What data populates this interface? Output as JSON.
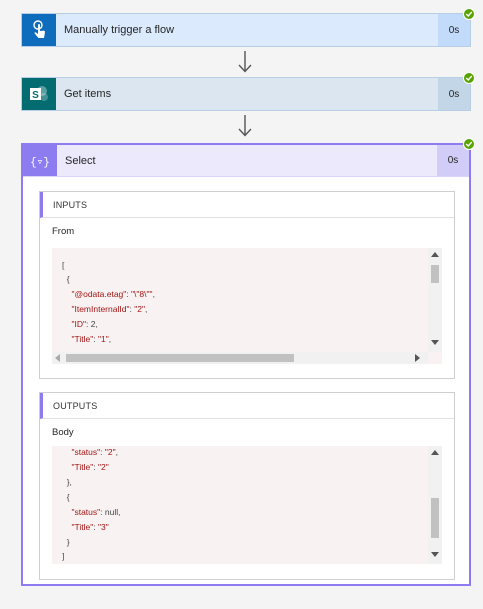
{
  "steps": [
    {
      "title": "Manually trigger a flow",
      "duration": "0s",
      "color": "#0f6cbd",
      "icon": "touch-icon"
    },
    {
      "title": "Get items",
      "duration": "0s",
      "color": "#036c70",
      "icon": "sharepoint-icon"
    }
  ],
  "select": {
    "title": "Select",
    "duration": "0s",
    "inputs": {
      "header": "INPUTS",
      "label": "From",
      "lines": [
        "[",
        "  {",
        "    \"@odata.etag\": \"\\\"8\\\"\",",
        "    \"ItemInternalId\": \"2\",",
        "    \"ID\": 2,",
        "    \"Title\": \"1\","
      ]
    },
    "outputs": {
      "header": "OUTPUTS",
      "label": "Body",
      "lines": [
        "    \"status\": \"2\",",
        "    \"Title\": \"2\"",
        "  },",
        "  {",
        "    \"status\": null,",
        "    \"Title\": \"3\"",
        "  }",
        "]"
      ]
    }
  },
  "colors": {
    "accent": "#8c7cf0",
    "success": "#57a300"
  }
}
